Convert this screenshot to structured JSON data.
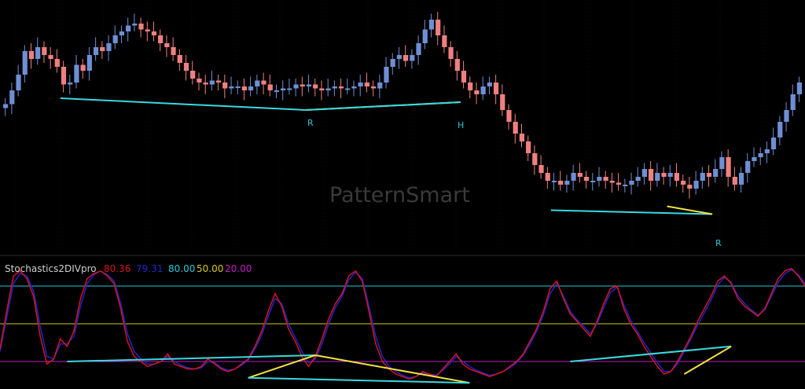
{
  "watermark": "PatternSmart",
  "colors": {
    "background": "#000000",
    "bull_candle": "#6f8fd4",
    "bear_candle": "#f08080",
    "divergence_main": "#3ad9e0",
    "divergence_hidden": "#f2e341",
    "stoch_k": "#d4161b",
    "stoch_d": "#2424cc",
    "level_80": "#29c6d9",
    "level_50": "#d8c81a",
    "level_20": "#c21cc2"
  },
  "indicator": {
    "name": "Stochastics2DIVpro",
    "values": [
      {
        "text": "80.36",
        "color": "#d4161b"
      },
      {
        "text": "79.31",
        "color": "#2424cc"
      },
      {
        "text": "80.00",
        "color": "#29c6d9"
      },
      {
        "text": "50.00",
        "color": "#d8c81a"
      },
      {
        "text": "20.00",
        "color": "#c21cc2"
      }
    ],
    "levels": [
      80,
      50,
      20
    ]
  },
  "chart_data": [
    {
      "type": "candlestick",
      "panel": "price",
      "title": "",
      "close": [
        0.55,
        0.62,
        0.7,
        0.82,
        0.78,
        0.84,
        0.8,
        0.78,
        0.74,
        0.65,
        0.66,
        0.75,
        0.72,
        0.8,
        0.84,
        0.82,
        0.86,
        0.9,
        0.92,
        0.95,
        0.96,
        0.93,
        0.92,
        0.9,
        0.86,
        0.84,
        0.8,
        0.76,
        0.72,
        0.68,
        0.66,
        0.65,
        0.67,
        0.66,
        0.63,
        0.64,
        0.64,
        0.62,
        0.64,
        0.67,
        0.65,
        0.62,
        0.62,
        0.63,
        0.63,
        0.65,
        0.64,
        0.65,
        0.63,
        0.62,
        0.63,
        0.64,
        0.63,
        0.63,
        0.64,
        0.66,
        0.64,
        0.63,
        0.66,
        0.74,
        0.78,
        0.8,
        0.77,
        0.8,
        0.86,
        0.93,
        0.98,
        0.9,
        0.84,
        0.78,
        0.72,
        0.66,
        0.62,
        0.6,
        0.64,
        0.66,
        0.6,
        0.52,
        0.46,
        0.4,
        0.36,
        0.3,
        0.24,
        0.2,
        0.16,
        0.16,
        0.14,
        0.16,
        0.2,
        0.18,
        0.16,
        0.16,
        0.18,
        0.16,
        0.15,
        0.14,
        0.14,
        0.16,
        0.18,
        0.22,
        0.16,
        0.2,
        0.18,
        0.2,
        0.16,
        0.14,
        0.12,
        0.16,
        0.2,
        0.18,
        0.22,
        0.28,
        0.18,
        0.14,
        0.2,
        0.26,
        0.28,
        0.3,
        0.32,
        0.38,
        0.46,
        0.52,
        0.6,
        0.66
      ],
      "annotations": [
        "R",
        "H",
        "R"
      ]
    },
    {
      "type": "line",
      "panel": "oscillator",
      "title": "Stochastics2DIVpro",
      "series_k": [
        30,
        60,
        88,
        92,
        86,
        72,
        40,
        18,
        22,
        38,
        32,
        44,
        70,
        86,
        90,
        92,
        88,
        82,
        62,
        36,
        24,
        20,
        16,
        18,
        20,
        26,
        18,
        16,
        14,
        14,
        16,
        22,
        18,
        14,
        12,
        14,
        18,
        22,
        32,
        44,
        60,
        74,
        64,
        46,
        36,
        24,
        16,
        24,
        38,
        54,
        66,
        74,
        88,
        92,
        84,
        60,
        34,
        20,
        14,
        10,
        8,
        6,
        8,
        12,
        10,
        8,
        14,
        20,
        26,
        18,
        14,
        12,
        10,
        8,
        10,
        12,
        16,
        20,
        26,
        36,
        46,
        60,
        78,
        84,
        70,
        58,
        52,
        46,
        40,
        52,
        66,
        78,
        80,
        62,
        50,
        42,
        32,
        24,
        16,
        10,
        12,
        20,
        30,
        40,
        52,
        62,
        72,
        84,
        88,
        82,
        70,
        64,
        60,
        56,
        62,
        74,
        86,
        92,
        94,
        88,
        80
      ],
      "series_d": [
        28,
        55,
        82,
        90,
        88,
        76,
        48,
        24,
        22,
        34,
        34,
        40,
        64,
        82,
        89,
        92,
        89,
        84,
        66,
        42,
        28,
        22,
        18,
        18,
        20,
        24,
        20,
        17,
        15,
        14,
        15,
        20,
        19,
        15,
        13,
        14,
        17,
        21,
        30,
        41,
        56,
        70,
        66,
        50,
        39,
        28,
        19,
        22,
        34,
        50,
        63,
        72,
        85,
        91,
        86,
        64,
        40,
        24,
        16,
        12,
        9,
        7,
        8,
        11,
        10,
        9,
        13,
        18,
        24,
        20,
        16,
        13,
        11,
        9,
        10,
        12,
        15,
        19,
        25,
        34,
        44,
        57,
        74,
        82,
        72,
        60,
        53,
        48,
        42,
        50,
        63,
        75,
        79,
        65,
        53,
        44,
        35,
        27,
        19,
        12,
        12,
        18,
        28,
        38,
        49,
        59,
        69,
        81,
        87,
        83,
        72,
        66,
        61,
        57,
        61,
        72,
        83,
        90,
        93,
        89,
        82
      ],
      "levels": [
        80,
        50,
        20
      ],
      "ylim": [
        0,
        100
      ]
    }
  ]
}
